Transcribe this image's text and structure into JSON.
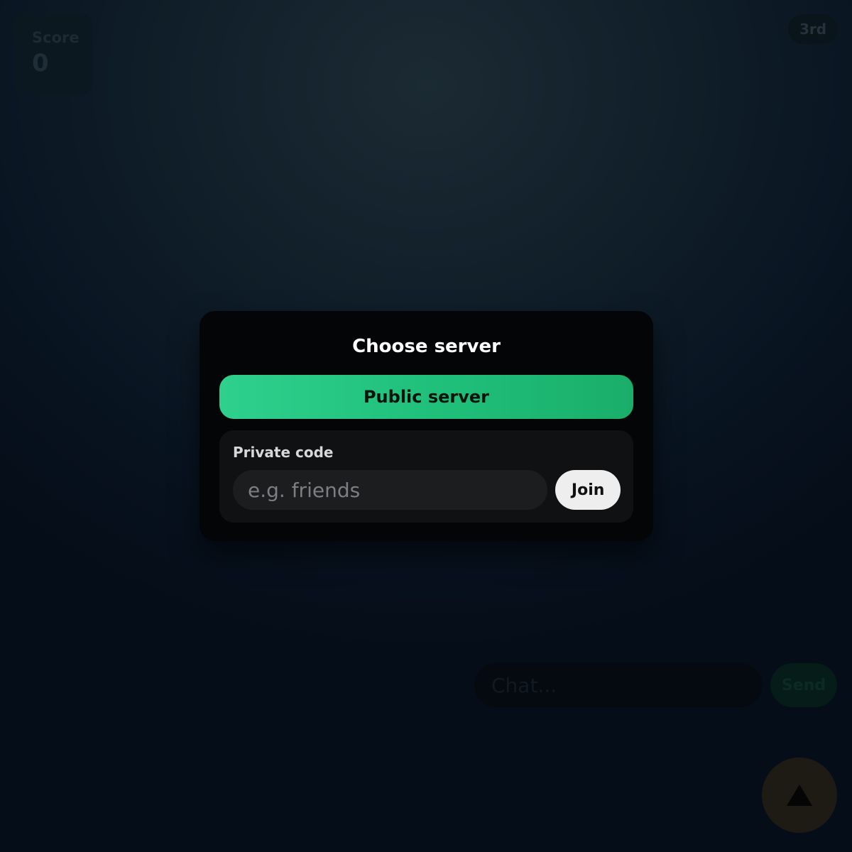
{
  "hud": {
    "score_label": "Score",
    "score_value": "0",
    "rank": "3rd"
  },
  "chat": {
    "placeholder": "Chat...",
    "send_label": "Send"
  },
  "action_button": {
    "icon": "triangle-up-icon"
  },
  "modal": {
    "title": "Choose server",
    "public_label": "Public server",
    "private_label": "Private code",
    "code_placeholder": "e.g. friends",
    "join_label": "Join"
  },
  "colors": {
    "accent_green": "#2ed08d",
    "modal_bg": "#030507",
    "panel_bg": "#101113",
    "join_bg": "#eeeeee"
  }
}
